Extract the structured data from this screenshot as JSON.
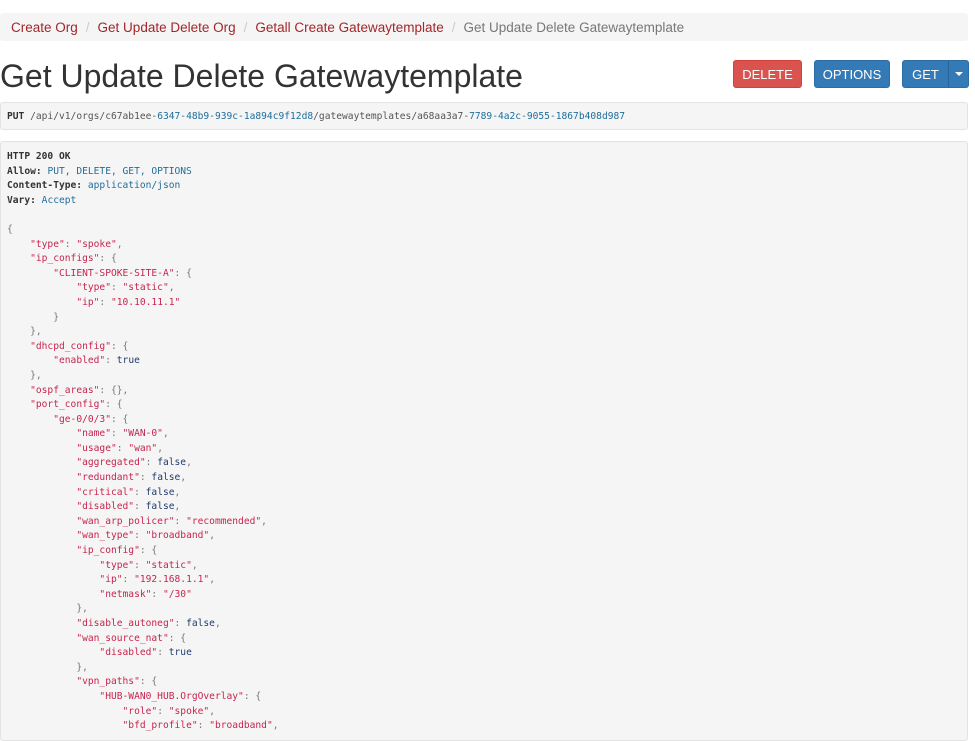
{
  "breadcrumb": {
    "items": [
      "Create Org",
      "Get Update Delete Org",
      "Getall Create Gatewaytemplate"
    ],
    "current": "Get Update Delete Gatewaytemplate"
  },
  "page_title": "Get Update Delete Gatewaytemplate",
  "buttons": {
    "delete": "DELETE",
    "options": "OPTIONS",
    "get": "GET"
  },
  "request": {
    "method": "PUT",
    "path_prefix": "/api/v1/orgs/c67ab1ee-",
    "org_rest": "6347-48b9-939c-1a894c9f12d8",
    "path_mid": "/gatewaytemplates/a68aa3a7-",
    "tmpl_rest": "7789-4a2c-9055-1867b408d987"
  },
  "response": {
    "status": "HTTP 200 OK",
    "headers": [
      {
        "key": "Allow:",
        "value": "PUT, DELETE, GET, OPTIONS"
      },
      {
        "key": "Content-Type:",
        "value": "application/json"
      },
      {
        "key": "Vary:",
        "value": "Accept"
      }
    ],
    "body_lines": [
      [
        [
          "p",
          "{"
        ]
      ],
      [
        [
          "ws",
          "    "
        ],
        [
          "k",
          "\"type\""
        ],
        [
          "p",
          ": "
        ],
        [
          "s",
          "\"spoke\""
        ],
        [
          "p",
          ","
        ]
      ],
      [
        [
          "ws",
          "    "
        ],
        [
          "k",
          "\"ip_configs\""
        ],
        [
          "p",
          ": {"
        ]
      ],
      [
        [
          "ws",
          "        "
        ],
        [
          "k",
          "\"CLIENT-SPOKE-SITE-A\""
        ],
        [
          "p",
          ": {"
        ]
      ],
      [
        [
          "ws",
          "            "
        ],
        [
          "k",
          "\"type\""
        ],
        [
          "p",
          ": "
        ],
        [
          "s",
          "\"static\""
        ],
        [
          "p",
          ","
        ]
      ],
      [
        [
          "ws",
          "            "
        ],
        [
          "k",
          "\"ip\""
        ],
        [
          "p",
          ": "
        ],
        [
          "s",
          "\"10.10.11.1\""
        ]
      ],
      [
        [
          "ws",
          "        "
        ],
        [
          "p",
          "}"
        ]
      ],
      [
        [
          "ws",
          "    "
        ],
        [
          "p",
          "},"
        ]
      ],
      [
        [
          "ws",
          "    "
        ],
        [
          "k",
          "\"dhcpd_config\""
        ],
        [
          "p",
          ": {"
        ]
      ],
      [
        [
          "ws",
          "        "
        ],
        [
          "k",
          "\"enabled\""
        ],
        [
          "p",
          ": "
        ],
        [
          "lit",
          "true"
        ]
      ],
      [
        [
          "ws",
          "    "
        ],
        [
          "p",
          "},"
        ]
      ],
      [
        [
          "ws",
          "    "
        ],
        [
          "k",
          "\"ospf_areas\""
        ],
        [
          "p",
          ": {},"
        ]
      ],
      [
        [
          "ws",
          "    "
        ],
        [
          "k",
          "\"port_config\""
        ],
        [
          "p",
          ": {"
        ]
      ],
      [
        [
          "ws",
          "        "
        ],
        [
          "k",
          "\"ge-0/0/3\""
        ],
        [
          "p",
          ": {"
        ]
      ],
      [
        [
          "ws",
          "            "
        ],
        [
          "k",
          "\"name\""
        ],
        [
          "p",
          ": "
        ],
        [
          "s",
          "\"WAN-0\""
        ],
        [
          "p",
          ","
        ]
      ],
      [
        [
          "ws",
          "            "
        ],
        [
          "k",
          "\"usage\""
        ],
        [
          "p",
          ": "
        ],
        [
          "s",
          "\"wan\""
        ],
        [
          "p",
          ","
        ]
      ],
      [
        [
          "ws",
          "            "
        ],
        [
          "k",
          "\"aggregated\""
        ],
        [
          "p",
          ": "
        ],
        [
          "lit",
          "false"
        ],
        [
          "p",
          ","
        ]
      ],
      [
        [
          "ws",
          "            "
        ],
        [
          "k",
          "\"redundant\""
        ],
        [
          "p",
          ": "
        ],
        [
          "lit",
          "false"
        ],
        [
          "p",
          ","
        ]
      ],
      [
        [
          "ws",
          "            "
        ],
        [
          "k",
          "\"critical\""
        ],
        [
          "p",
          ": "
        ],
        [
          "lit",
          "false"
        ],
        [
          "p",
          ","
        ]
      ],
      [
        [
          "ws",
          "            "
        ],
        [
          "k",
          "\"disabled\""
        ],
        [
          "p",
          ": "
        ],
        [
          "lit",
          "false"
        ],
        [
          "p",
          ","
        ]
      ],
      [
        [
          "ws",
          "            "
        ],
        [
          "k",
          "\"wan_arp_policer\""
        ],
        [
          "p",
          ": "
        ],
        [
          "s",
          "\"recommended\""
        ],
        [
          "p",
          ","
        ]
      ],
      [
        [
          "ws",
          "            "
        ],
        [
          "k",
          "\"wan_type\""
        ],
        [
          "p",
          ": "
        ],
        [
          "s",
          "\"broadband\""
        ],
        [
          "p",
          ","
        ]
      ],
      [
        [
          "ws",
          "            "
        ],
        [
          "k",
          "\"ip_config\""
        ],
        [
          "p",
          ": {"
        ]
      ],
      [
        [
          "ws",
          "                "
        ],
        [
          "k",
          "\"type\""
        ],
        [
          "p",
          ": "
        ],
        [
          "s",
          "\"static\""
        ],
        [
          "p",
          ","
        ]
      ],
      [
        [
          "ws",
          "                "
        ],
        [
          "k",
          "\"ip\""
        ],
        [
          "p",
          ": "
        ],
        [
          "s",
          "\"192.168.1.1\""
        ],
        [
          "p",
          ","
        ]
      ],
      [
        [
          "ws",
          "                "
        ],
        [
          "k",
          "\"netmask\""
        ],
        [
          "p",
          ": "
        ],
        [
          "s",
          "\"/30\""
        ]
      ],
      [
        [
          "ws",
          "            "
        ],
        [
          "p",
          "},"
        ]
      ],
      [
        [
          "ws",
          "            "
        ],
        [
          "k",
          "\"disable_autoneg\""
        ],
        [
          "p",
          ": "
        ],
        [
          "lit",
          "false"
        ],
        [
          "p",
          ","
        ]
      ],
      [
        [
          "ws",
          "            "
        ],
        [
          "k",
          "\"wan_source_nat\""
        ],
        [
          "p",
          ": {"
        ]
      ],
      [
        [
          "ws",
          "                "
        ],
        [
          "k",
          "\"disabled\""
        ],
        [
          "p",
          ": "
        ],
        [
          "lit",
          "true"
        ]
      ],
      [
        [
          "ws",
          "            "
        ],
        [
          "p",
          "},"
        ]
      ],
      [
        [
          "ws",
          "            "
        ],
        [
          "k",
          "\"vpn_paths\""
        ],
        [
          "p",
          ": {"
        ]
      ],
      [
        [
          "ws",
          "                "
        ],
        [
          "k",
          "\"HUB-WAN0_HUB.OrgOverlay\""
        ],
        [
          "p",
          ": {"
        ]
      ],
      [
        [
          "ws",
          "                    "
        ],
        [
          "k",
          "\"role\""
        ],
        [
          "p",
          ": "
        ],
        [
          "s",
          "\"spoke\""
        ],
        [
          "p",
          ","
        ]
      ],
      [
        [
          "ws",
          "                    "
        ],
        [
          "k",
          "\"bfd_profile\""
        ],
        [
          "p",
          ": "
        ],
        [
          "s",
          "\"broadband\""
        ],
        [
          "p",
          ","
        ]
      ]
    ]
  }
}
